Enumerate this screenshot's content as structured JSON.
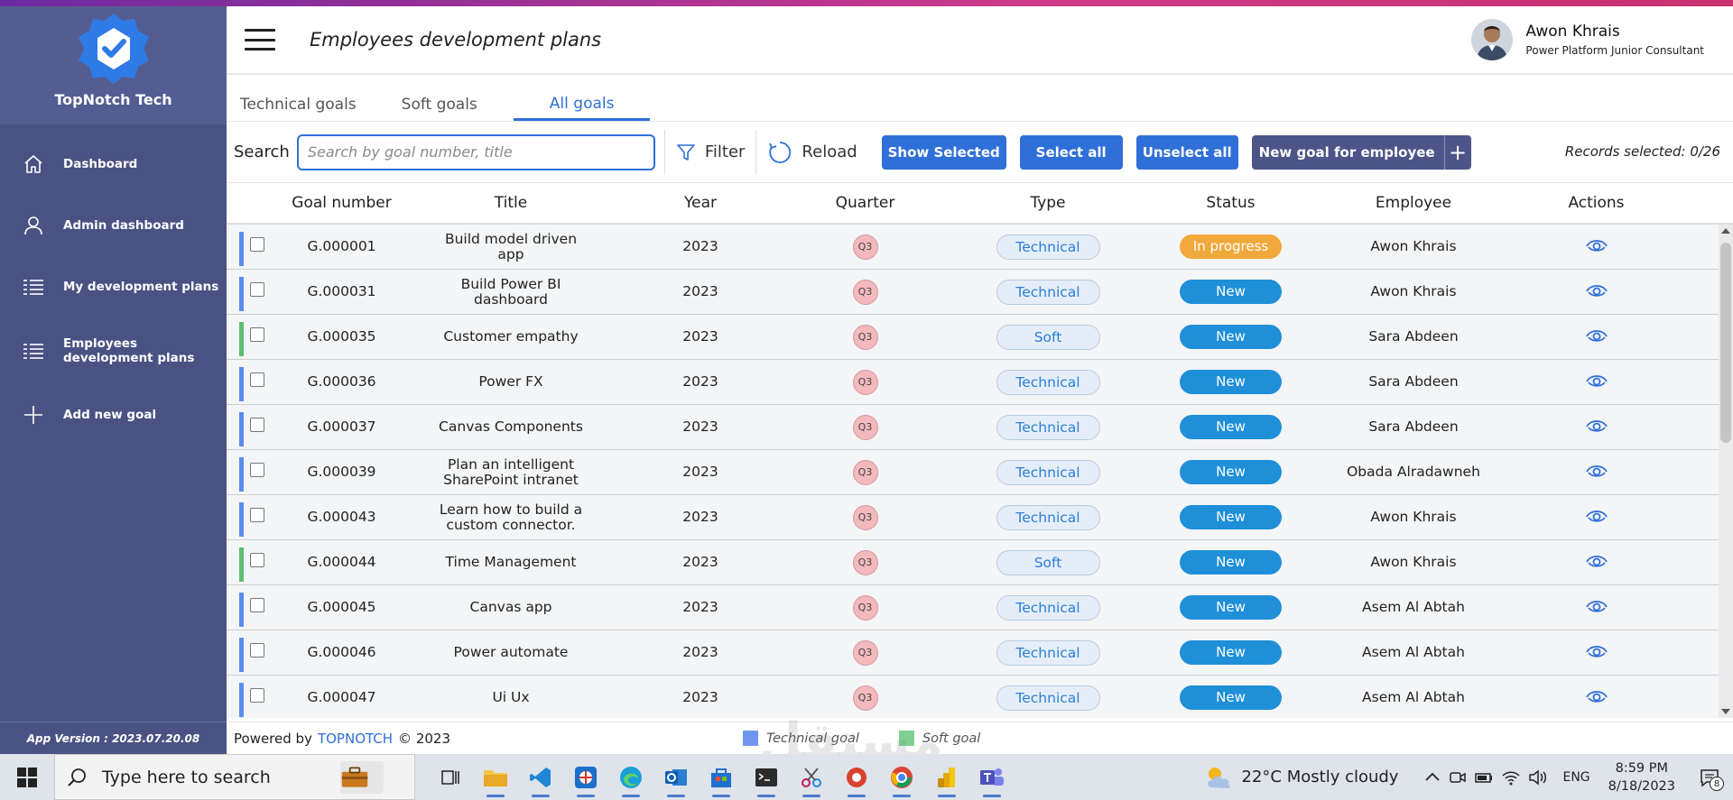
{
  "brand": {
    "name": "TopNotch Tech"
  },
  "sidebar": {
    "items": [
      {
        "label": "Dashboard",
        "icon": "home-icon"
      },
      {
        "label": "Admin dashboard",
        "icon": "user-icon"
      },
      {
        "label": "My development plans",
        "icon": "list-icon"
      },
      {
        "label": "Employees development plans",
        "icon": "list-icon"
      },
      {
        "label": "Add new goal",
        "icon": "plus-icon"
      }
    ],
    "app_version": "App Version : 2023.07.20.08"
  },
  "header": {
    "title": "Employees development plans",
    "user_name": "Awon Khrais",
    "user_role": "Power Platform Junior Consultant"
  },
  "tabs": [
    {
      "label": "Technical goals",
      "active": false
    },
    {
      "label": "Soft goals",
      "active": false
    },
    {
      "label": "All goals",
      "active": true
    }
  ],
  "toolbar": {
    "search_label": "Search",
    "search_placeholder": "Search by goal number, title",
    "search_value": "",
    "filter_label": "Filter",
    "reload_label": "Reload",
    "show_selected": "Show Selected",
    "select_all": "Select all",
    "unselect_all": "Unselect all",
    "new_goal": "New goal for employee",
    "new_goal_plus": "+",
    "records_selected": "Records selected: 0/26"
  },
  "table": {
    "columns": [
      "Goal number",
      "Title",
      "Year",
      "Quarter",
      "Type",
      "Status",
      "Employee",
      "Actions"
    ],
    "rows": [
      {
        "goal": "G.000001",
        "title": "Build model driven app",
        "year": "2023",
        "quarter": "Q3",
        "type": "Technical",
        "status": "In progress",
        "employee": "Awon Khrais"
      },
      {
        "goal": "G.000031",
        "title": "Build Power BI dashboard",
        "year": "2023",
        "quarter": "Q3",
        "type": "Technical",
        "status": "New",
        "employee": "Awon Khrais"
      },
      {
        "goal": "G.000035",
        "title": "Customer empathy",
        "year": "2023",
        "quarter": "Q3",
        "type": "Soft",
        "status": "New",
        "employee": "Sara Abdeen"
      },
      {
        "goal": "G.000036",
        "title": "Power FX",
        "year": "2023",
        "quarter": "Q3",
        "type": "Technical",
        "status": "New",
        "employee": "Sara Abdeen"
      },
      {
        "goal": "G.000037",
        "title": "Canvas Components",
        "year": "2023",
        "quarter": "Q3",
        "type": "Technical",
        "status": "New",
        "employee": "Sara Abdeen"
      },
      {
        "goal": "G.000039",
        "title": "Plan an intelligent SharePoint intranet",
        "year": "2023",
        "quarter": "Q3",
        "type": "Technical",
        "status": "New",
        "employee": "Obada Alradawneh"
      },
      {
        "goal": "G.000043",
        "title": "Learn how to build a custom connector.",
        "year": "2023",
        "quarter": "Q3",
        "type": "Technical",
        "status": "New",
        "employee": "Awon Khrais"
      },
      {
        "goal": "G.000044",
        "title": "Time Management",
        "year": "2023",
        "quarter": "Q3",
        "type": "Soft",
        "status": "New",
        "employee": "Awon Khrais"
      },
      {
        "goal": "G.000045",
        "title": "Canvas app",
        "year": "2023",
        "quarter": "Q3",
        "type": "Technical",
        "status": "New",
        "employee": "Asem Al Abtah"
      },
      {
        "goal": "G.000046",
        "title": "Power automate",
        "year": "2023",
        "quarter": "Q3",
        "type": "Technical",
        "status": "New",
        "employee": "Asem Al Abtah"
      },
      {
        "goal": "G.000047",
        "title": "Ui Ux",
        "year": "2023",
        "quarter": "Q3",
        "type": "Technical",
        "status": "New",
        "employee": "Asem Al Abtah"
      }
    ]
  },
  "footer": {
    "powered_by": "Powered by",
    "brand": "TOPNOTCH",
    "copyright": "© 2023",
    "legend_technical": "Technical goal",
    "legend_soft": "Soft goal"
  },
  "colors": {
    "accent": "#2f6fd8",
    "sidebar": "#4a5283",
    "technical": "#5b8def",
    "soft": "#5cbf73",
    "status_new": "#1f8fd8",
    "status_in_progress": "#f2a93b"
  },
  "taskbar": {
    "search_placeholder": "Type here to search",
    "weather": "22°C  Mostly cloudy",
    "language": "ENG",
    "time": "8:59 PM",
    "date": "8/18/2023",
    "notifications": "8"
  },
  "watermark": "مستقل"
}
